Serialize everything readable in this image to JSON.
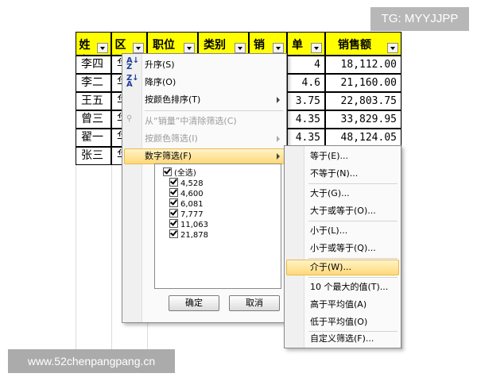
{
  "watermark": {
    "tg": "TG: MYYJJPP",
    "site": "www.52chenpangpang.cn"
  },
  "headers": [
    "姓名",
    "区域",
    "职位",
    "类别",
    "销量",
    "单价",
    "销售额"
  ],
  "rows": [
    {
      "name": "李四",
      "region": "华",
      "price": "4",
      "sales": "18,112.00"
    },
    {
      "name": "李二",
      "region": "华",
      "price": "4.6",
      "sales": "21,160.00"
    },
    {
      "name": "王五",
      "region": "华",
      "price": "3.75",
      "sales": "22,803.75"
    },
    {
      "name": "曾三",
      "region": "华",
      "price": "4.35",
      "sales": "33,829.95"
    },
    {
      "name": "翟一",
      "region": "华",
      "price": "4.35",
      "sales": "48,124.05"
    },
    {
      "name": "张三",
      "region": "华",
      "price": "",
      "sales": ""
    }
  ],
  "menu": {
    "sort_asc": "升序(S)",
    "sort_desc": "降序(O)",
    "sort_color": "按颜色排序(T)",
    "clear_filter": "从“销量”中清除筛选(C)",
    "filter_color": "按颜色筛选(I)",
    "number_filter": "数字筛选(F)",
    "list": [
      "(全选)",
      "4,528",
      "4,600",
      "6,081",
      "7,777",
      "11,063",
      "21,878"
    ],
    "ok": "确定",
    "cancel": "取消"
  },
  "submenu": {
    "items": [
      "等于(E)...",
      "不等于(N)...",
      "大于(G)...",
      "大于或等于(O)...",
      "小于(L)...",
      "小于或等于(Q)...",
      "介于(W)...",
      "10 个最大的值(T)...",
      "高于平均值(A)",
      "低于平均值(O)",
      "自定义筛选(F)..."
    ]
  },
  "colors": {
    "header_bg": "#ffff00",
    "highlight": "#ffd977"
  }
}
